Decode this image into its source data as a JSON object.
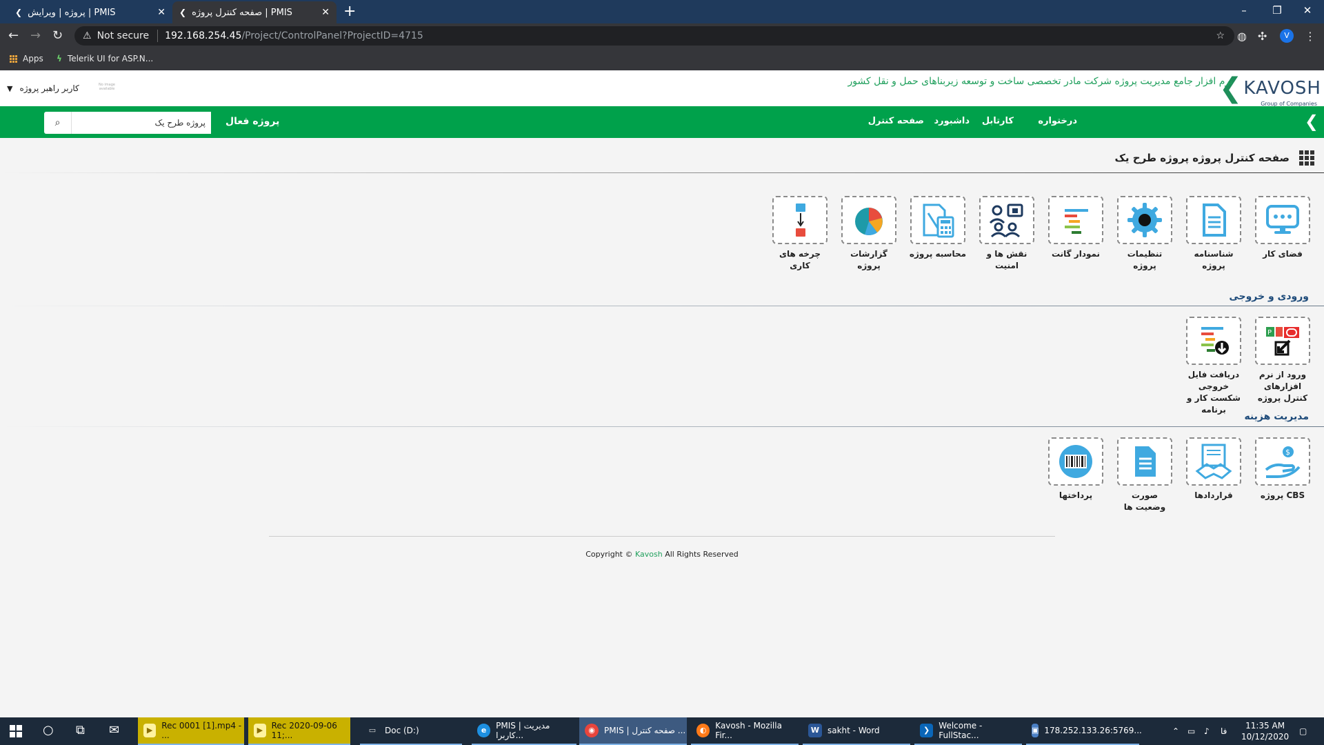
{
  "browser": {
    "tabs": [
      {
        "label": "پروژه | ویرایش | PMIS",
        "active": false
      },
      {
        "label": "صفحه کنترل پروژه | PMIS",
        "active": true
      }
    ],
    "security_label": "Not secure",
    "url_host": "192.168.254.45",
    "url_path": "/Project/ControlPanel?ProjectID=4715",
    "profile_initial": "V",
    "bookmarks": [
      {
        "label": "Apps"
      },
      {
        "label": "Telerik UI for ASP.N..."
      }
    ]
  },
  "header": {
    "logo_text": "KAVOSH",
    "logo_subtext": "Group of Companies",
    "tagline": "نرم افزار جامع مدیریت پروژه شرکت مادر تخصصی ساخت و توسعه زیربناهای حمل و نقل کشور",
    "user_label": "کاربر راهبر پروژه",
    "user_logo_text": "No image available"
  },
  "nav": {
    "items": [
      {
        "label": "درختواره"
      },
      {
        "label": "کارتابل"
      },
      {
        "label": "داشبورد"
      },
      {
        "label": "صفحه کنترل"
      }
    ],
    "active_project_label": "پروژه فعال",
    "search_value": "پروژه طرح یک"
  },
  "page": {
    "title": "صفحه کنترل پروژه پروژه طرح یک"
  },
  "tiles_main": [
    {
      "label": "فضای کار",
      "icon": "chat-monitor-icon"
    },
    {
      "label": "شناسنامه پروژه",
      "icon": "document-icon"
    },
    {
      "label": "تنظیمات پروژه",
      "icon": "gear-icon"
    },
    {
      "label": "نمودار گانت",
      "icon": "gantt-icon"
    },
    {
      "label": "نقش ها و امنیت",
      "icon": "users-lock-icon"
    },
    {
      "label": "محاسبه پروژه",
      "icon": "calculator-icon"
    },
    {
      "label": "گزارشات پروژه",
      "icon": "pie-chart-icon"
    },
    {
      "label": "چرخه های کاری",
      "icon": "workflow-icon"
    }
  ],
  "section_io": {
    "title": "ورودی و خروجی",
    "tiles": [
      {
        "label": "ورود از نرم افزارهای کنترل پروژه",
        "icon": "import-p6-icon"
      },
      {
        "label": "دریافت فایل خروجی شکست کار و برنامه",
        "icon": "download-gantt-icon"
      }
    ]
  },
  "section_cost": {
    "title": "مدیریت هزینه",
    "tiles": [
      {
        "label": "CBS پروژه",
        "icon": "money-hand-icon"
      },
      {
        "label": "قراردادها",
        "icon": "handshake-contract-icon"
      },
      {
        "label": "صورت وضعیت ها",
        "icon": "statement-icon"
      },
      {
        "label": "پرداختها",
        "icon": "barcode-icon"
      }
    ]
  },
  "footer": {
    "prefix": "Copyright ©",
    "brand": "Kavosh",
    "suffix": "All Rights Reserved"
  },
  "taskbar": {
    "apps": [
      {
        "label": "Rec 0001 [1].mp4 - ..."
      },
      {
        "label": "Rec 2020-09-06 11;..."
      },
      {
        "label": "Doc (D:)"
      },
      {
        "label": "PMIS | مدیریت کاربرا..."
      },
      {
        "label": "PMIS | صفحه کنترل ..."
      },
      {
        "label": "Kavosh - Mozilla Fir..."
      },
      {
        "label": "sakht - Word"
      },
      {
        "label": "Welcome - FullStac..."
      },
      {
        "label": "178.252.133.26:5769..."
      }
    ],
    "lang": "فا",
    "time": "11:35 AM",
    "date": "10/12/2020"
  }
}
